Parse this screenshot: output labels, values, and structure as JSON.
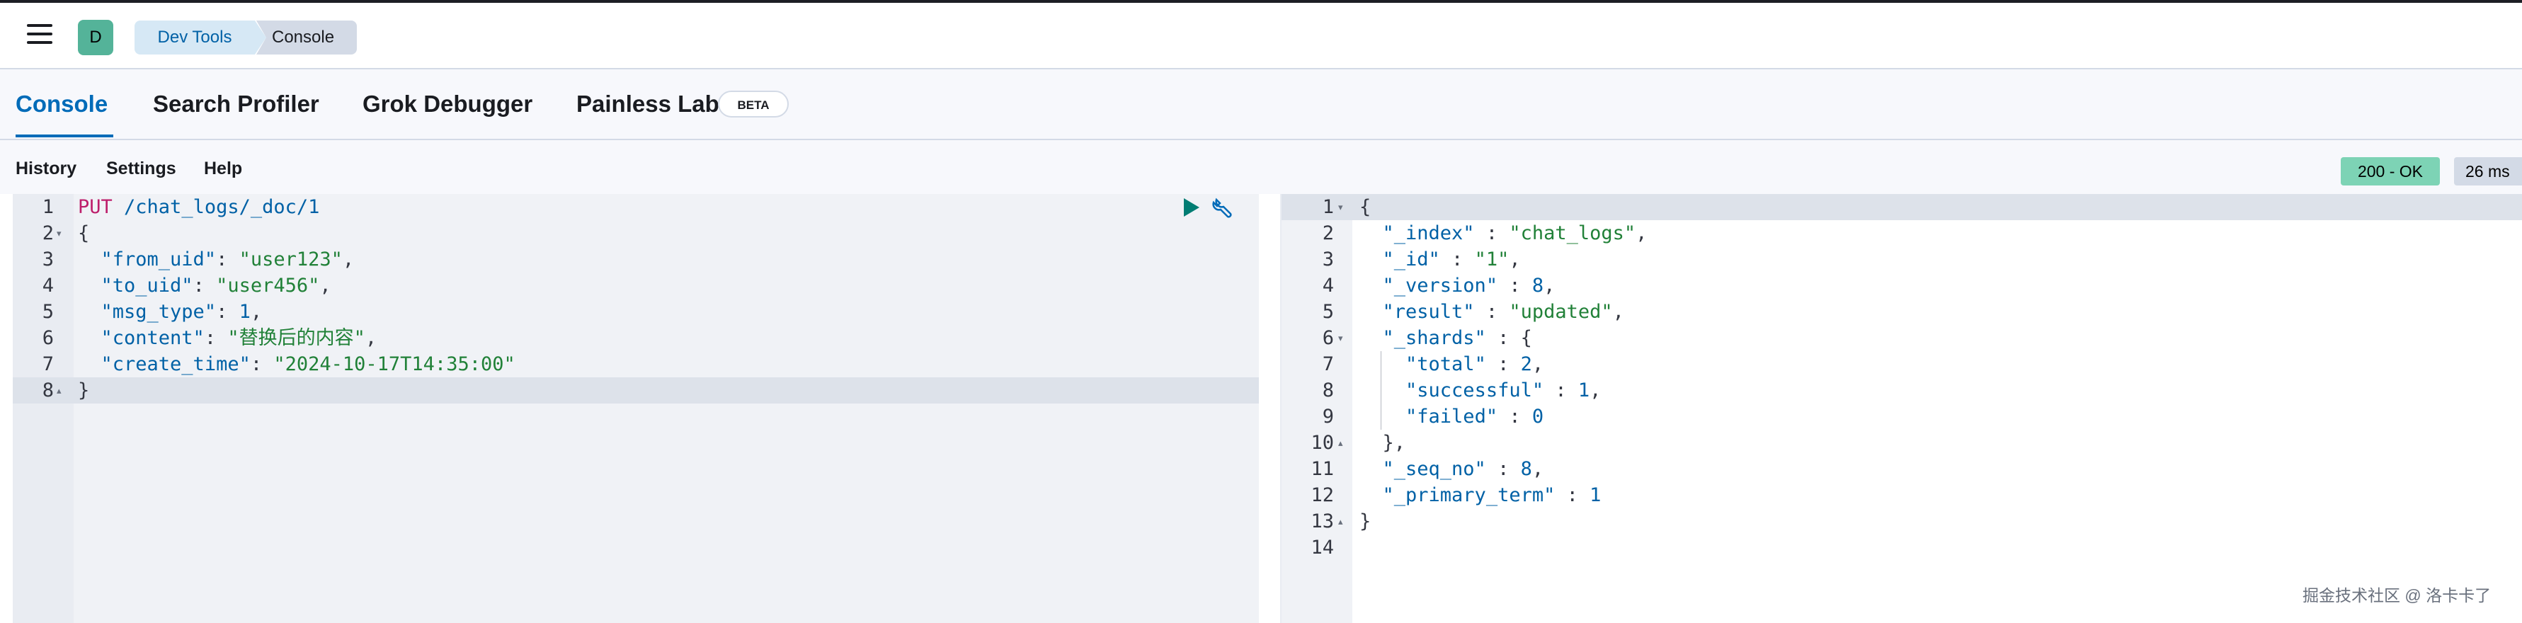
{
  "header": {
    "avatar_letter": "D",
    "breadcrumbs": [
      "Dev Tools",
      "Console"
    ]
  },
  "tabs": [
    {
      "label": "Console",
      "active": true
    },
    {
      "label": "Search Profiler"
    },
    {
      "label": "Grok Debugger"
    },
    {
      "label": "Painless Lab",
      "badge": "BETA"
    }
  ],
  "toolbar": {
    "history": "History",
    "settings": "Settings",
    "help": "Help",
    "status": "200 - OK",
    "time": "26 ms"
  },
  "request": {
    "method": "PUT",
    "path": " /chat_logs/_doc/1",
    "lines": [
      {
        "n": "1"
      },
      {
        "n": "2",
        "text": "{"
      },
      {
        "n": "3",
        "key": "\"from_uid\"",
        "sep": ": ",
        "value": "\"user123\"",
        "end": ","
      },
      {
        "n": "4",
        "key": "\"to_uid\"",
        "sep": ": ",
        "value": "\"user456\"",
        "end": ","
      },
      {
        "n": "5",
        "key": "\"msg_type\"",
        "sep": ": ",
        "value": "1",
        "end": ","
      },
      {
        "n": "6",
        "key": "\"content\"",
        "sep": ": ",
        "value": "\"替换后的内容\"",
        "end": ","
      },
      {
        "n": "7",
        "key": "\"create_time\"",
        "sep": ": ",
        "value": "\"2024-10-17T14:35:00\"",
        "end": ""
      },
      {
        "n": "8",
        "text": "}"
      }
    ]
  },
  "response": {
    "lines": [
      {
        "n": "1",
        "text": "{"
      },
      {
        "n": "2",
        "key": "\"_index\"",
        "sep": " : ",
        "value": "\"chat_logs\"",
        "end": ","
      },
      {
        "n": "3",
        "key": "\"_id\"",
        "sep": " : ",
        "value": "\"1\"",
        "end": ","
      },
      {
        "n": "4",
        "key": "\"_version\"",
        "sep": " : ",
        "value": "8",
        "end": ","
      },
      {
        "n": "5",
        "key": "\"result\"",
        "sep": " : ",
        "value": "\"updated\"",
        "end": ","
      },
      {
        "n": "6",
        "key": "\"_shards\"",
        "sep": " : ",
        "value": "{",
        "end": ""
      },
      {
        "n": "7",
        "key": "\"total\"",
        "sep": " : ",
        "value": "2",
        "end": ","
      },
      {
        "n": "8",
        "key": "\"successful\"",
        "sep": " : ",
        "value": "1",
        "end": ","
      },
      {
        "n": "9",
        "key": "\"failed\"",
        "sep": " : ",
        "value": "0",
        "end": ""
      },
      {
        "n": "10",
        "text": "},"
      },
      {
        "n": "11",
        "key": "\"_seq_no\"",
        "sep": " : ",
        "value": "8",
        "end": ","
      },
      {
        "n": "12",
        "key": "\"_primary_term\"",
        "sep": " : ",
        "value": "1",
        "end": ""
      },
      {
        "n": "13",
        "text": "}"
      },
      {
        "n": "14",
        "text": ""
      }
    ]
  },
  "watermark": "掘金技术社区 @ 洛卡卡了"
}
